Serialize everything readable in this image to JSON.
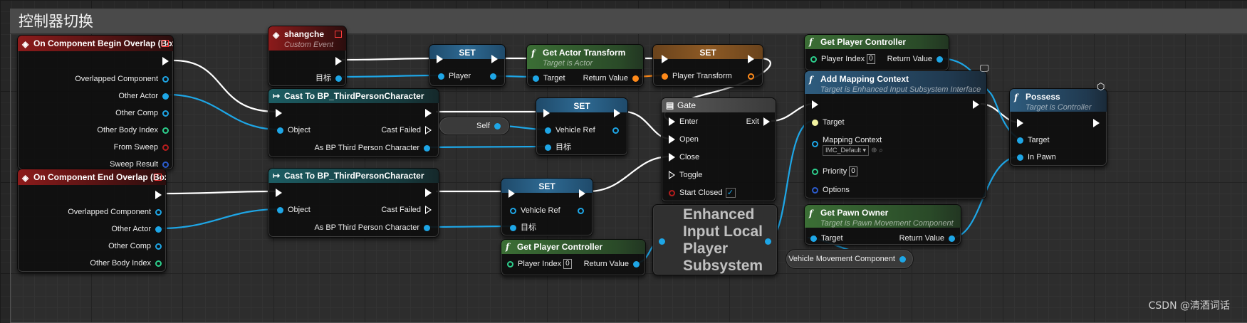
{
  "comment": {
    "title": "控制器切换"
  },
  "node_begin_overlap": {
    "title": "On Component Begin Overlap (Box)",
    "pins": [
      "Overlapped Component",
      "Other Actor",
      "Other Comp",
      "Other Body Index",
      "From Sweep",
      "Sweep Result"
    ]
  },
  "node_end_overlap": {
    "title": "On Component End Overlap (Box)",
    "pins": [
      "Overlapped Component",
      "Other Actor",
      "Other Comp",
      "Other Body Index"
    ]
  },
  "node_shangche": {
    "title": "shangche",
    "subtitle": "Custom Event",
    "pin_target": "目标"
  },
  "node_set_player": {
    "title": "SET",
    "pin": "Player"
  },
  "node_get_actor_transform": {
    "title": "Get Actor Transform",
    "subtitle": "Target is Actor",
    "pin_target": "Target",
    "pin_return": "Return Value"
  },
  "node_set_transform": {
    "title": "SET",
    "pin": "Player Transform"
  },
  "node_cast1": {
    "title": "Cast To BP_ThirdPersonCharacter",
    "pin_object": "Object",
    "pin_failed": "Cast Failed",
    "pin_as": "As BP Third Person Character"
  },
  "node_self": {
    "label": "Self"
  },
  "node_set_vehicle1": {
    "title": "SET",
    "pin_vehicle": "Vehicle Ref",
    "pin_target": "目标"
  },
  "node_cast2": {
    "title": "Cast To BP_ThirdPersonCharacter",
    "pin_object": "Object",
    "pin_failed": "Cast Failed",
    "pin_as": "As BP Third Person Character"
  },
  "node_set_vehicle2": {
    "title": "SET",
    "pin_vehicle": "Vehicle Ref",
    "pin_target": "目标"
  },
  "node_gate": {
    "title": "Gate",
    "pins": [
      "Enter",
      "Open",
      "Close",
      "Toggle",
      "Start Closed"
    ],
    "pin_exit": "Exit",
    "start_closed": true
  },
  "node_get_pc_top": {
    "title": "Get Player Controller",
    "pin_index": "Player Index",
    "index_value": "0",
    "pin_return": "Return Value"
  },
  "node_add_mapping": {
    "title": "Add Mapping Context",
    "subtitle": "Target is Enhanced Input Subsystem Interface",
    "pin_target": "Target",
    "pin_mapping": "Mapping Context",
    "mapping_value": "IMC_Default",
    "pin_priority": "Priority",
    "priority_value": "0",
    "pin_options": "Options"
  },
  "node_possess": {
    "title": "Possess",
    "subtitle": "Target is Controller",
    "pin_target": "Target",
    "pin_pawn": "In Pawn"
  },
  "node_get_pc_bottom": {
    "title": "Get Player Controller",
    "pin_index": "Player Index",
    "index_value": "0",
    "pin_return": "Return Value"
  },
  "node_subsystem": {
    "lines": [
      "Enhanced",
      "Input Local",
      "Player",
      "Subsystem"
    ]
  },
  "node_get_pawn_owner": {
    "title": "Get Pawn Owner",
    "subtitle": "Target is Pawn Movement Component",
    "pin_target": "Target",
    "pin_return": "Return Value"
  },
  "node_vehicle_movement": {
    "label": "Vehicle Movement Component"
  },
  "watermark": "CSDN @清酒词话",
  "icons": [
    "event-diamond-icon",
    "function-f-icon",
    "cast-arrow-icon",
    "gate-icon",
    "monitor-icon",
    "cube-icon"
  ]
}
